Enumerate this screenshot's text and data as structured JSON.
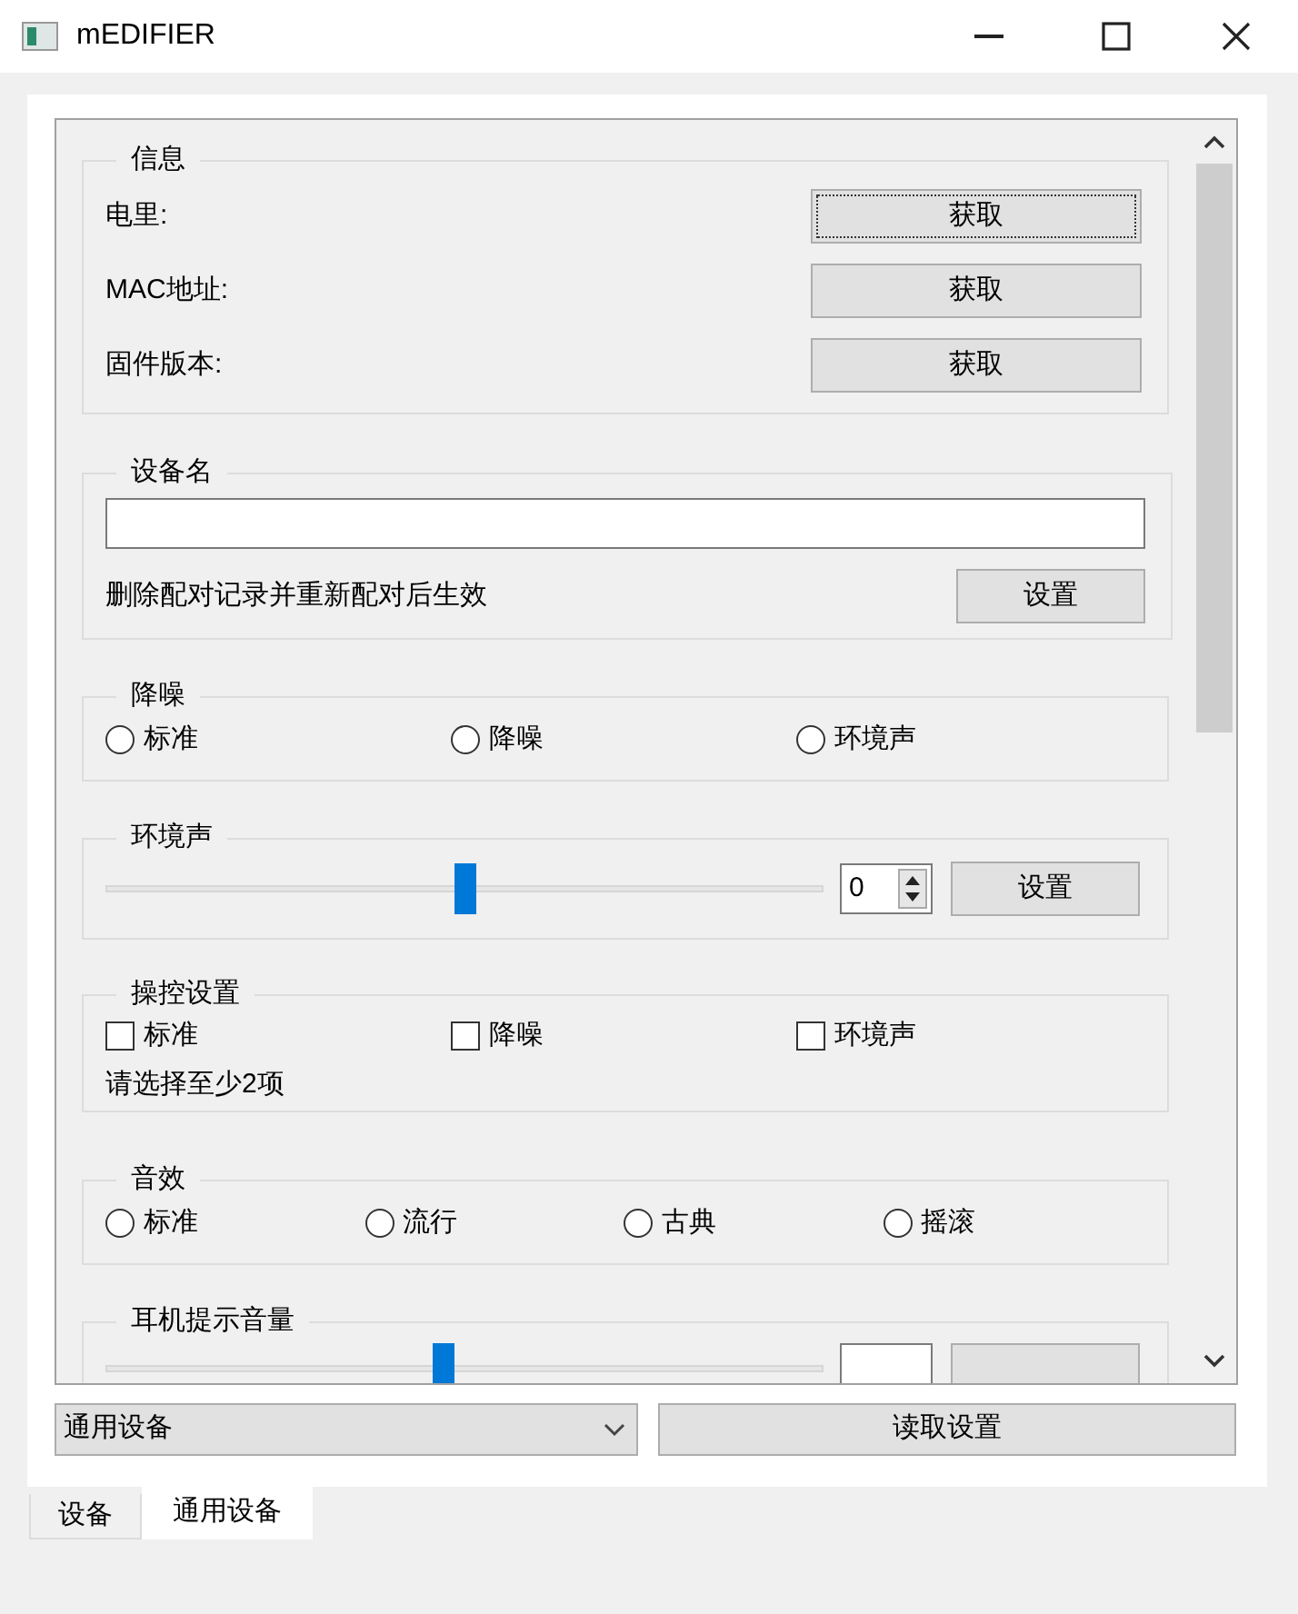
{
  "window": {
    "title": "mEDIFIER"
  },
  "info": {
    "title": "信息",
    "rows": [
      {
        "label": "电里:",
        "button": "获取"
      },
      {
        "label": "MAC地址:",
        "button": "获取"
      },
      {
        "label": "固件版本:",
        "button": "获取"
      }
    ]
  },
  "device_name": {
    "title": "设备名",
    "note": "删除配对记录并重新配对后生效",
    "button": "设置"
  },
  "noise_control": {
    "title": "降噪",
    "options": [
      {
        "label": "标准",
        "selected": false
      },
      {
        "label": "降噪",
        "selected": false
      },
      {
        "label": "环境声",
        "selected": false
      }
    ]
  },
  "ambient_sound": {
    "title": "环境声",
    "level": 0.5,
    "spin_value": "0",
    "button": "设置"
  },
  "control_settings": {
    "title": "操控设置",
    "options": [
      {
        "label": "标准",
        "checked": false
      },
      {
        "label": "降噪",
        "checked": false
      },
      {
        "label": "环境声",
        "checked": false
      }
    ],
    "note": "请选择至少2项"
  },
  "sound_effect": {
    "title": "音效",
    "options": [
      {
        "label": "标准",
        "selected": false
      },
      {
        "label": "流行",
        "selected": false
      },
      {
        "label": "古典",
        "selected": false
      },
      {
        "label": "摇滚",
        "selected": false
      }
    ]
  },
  "prompt_volume": {
    "title": "耳机提示音量",
    "level": 0.47
  },
  "device_select": {
    "value": "通用设备"
  },
  "read_button": "读取设置",
  "tabs": [
    {
      "label": "设备",
      "selected": false
    },
    {
      "label": "通用设备",
      "selected": true
    }
  ]
}
